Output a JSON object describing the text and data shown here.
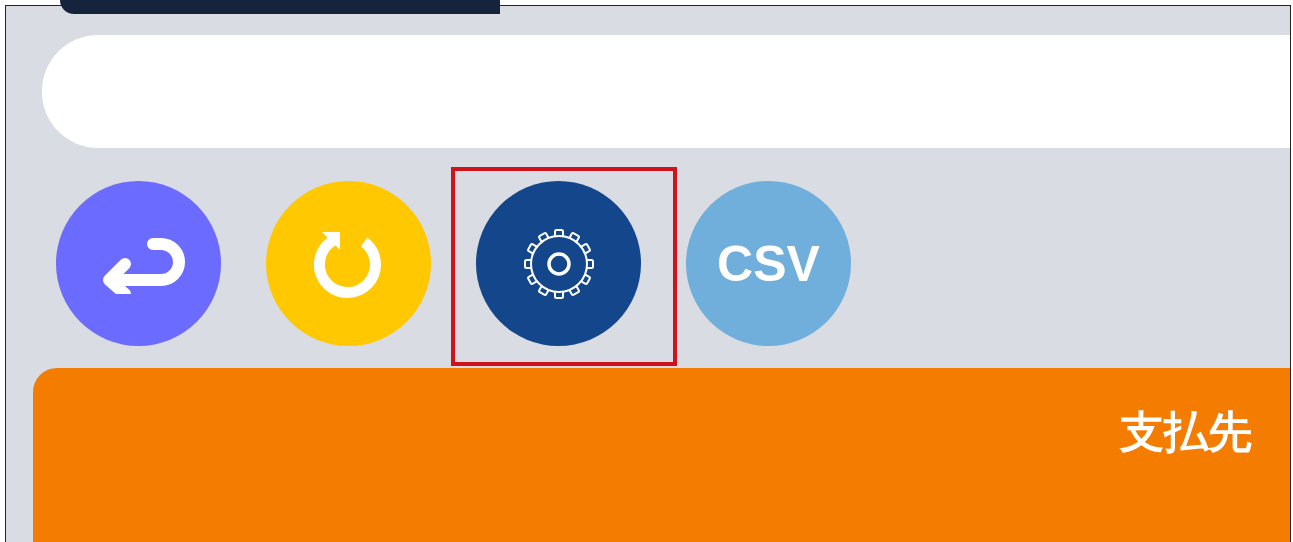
{
  "toolbar": [
    {
      "kind": "back",
      "highlighted": false
    },
    {
      "kind": "refresh",
      "highlighted": false
    },
    {
      "kind": "settings",
      "highlighted": true
    },
    {
      "kind": "csv",
      "label": "CSV",
      "highlighted": false
    }
  ],
  "panel": {
    "title": "支払先"
  }
}
